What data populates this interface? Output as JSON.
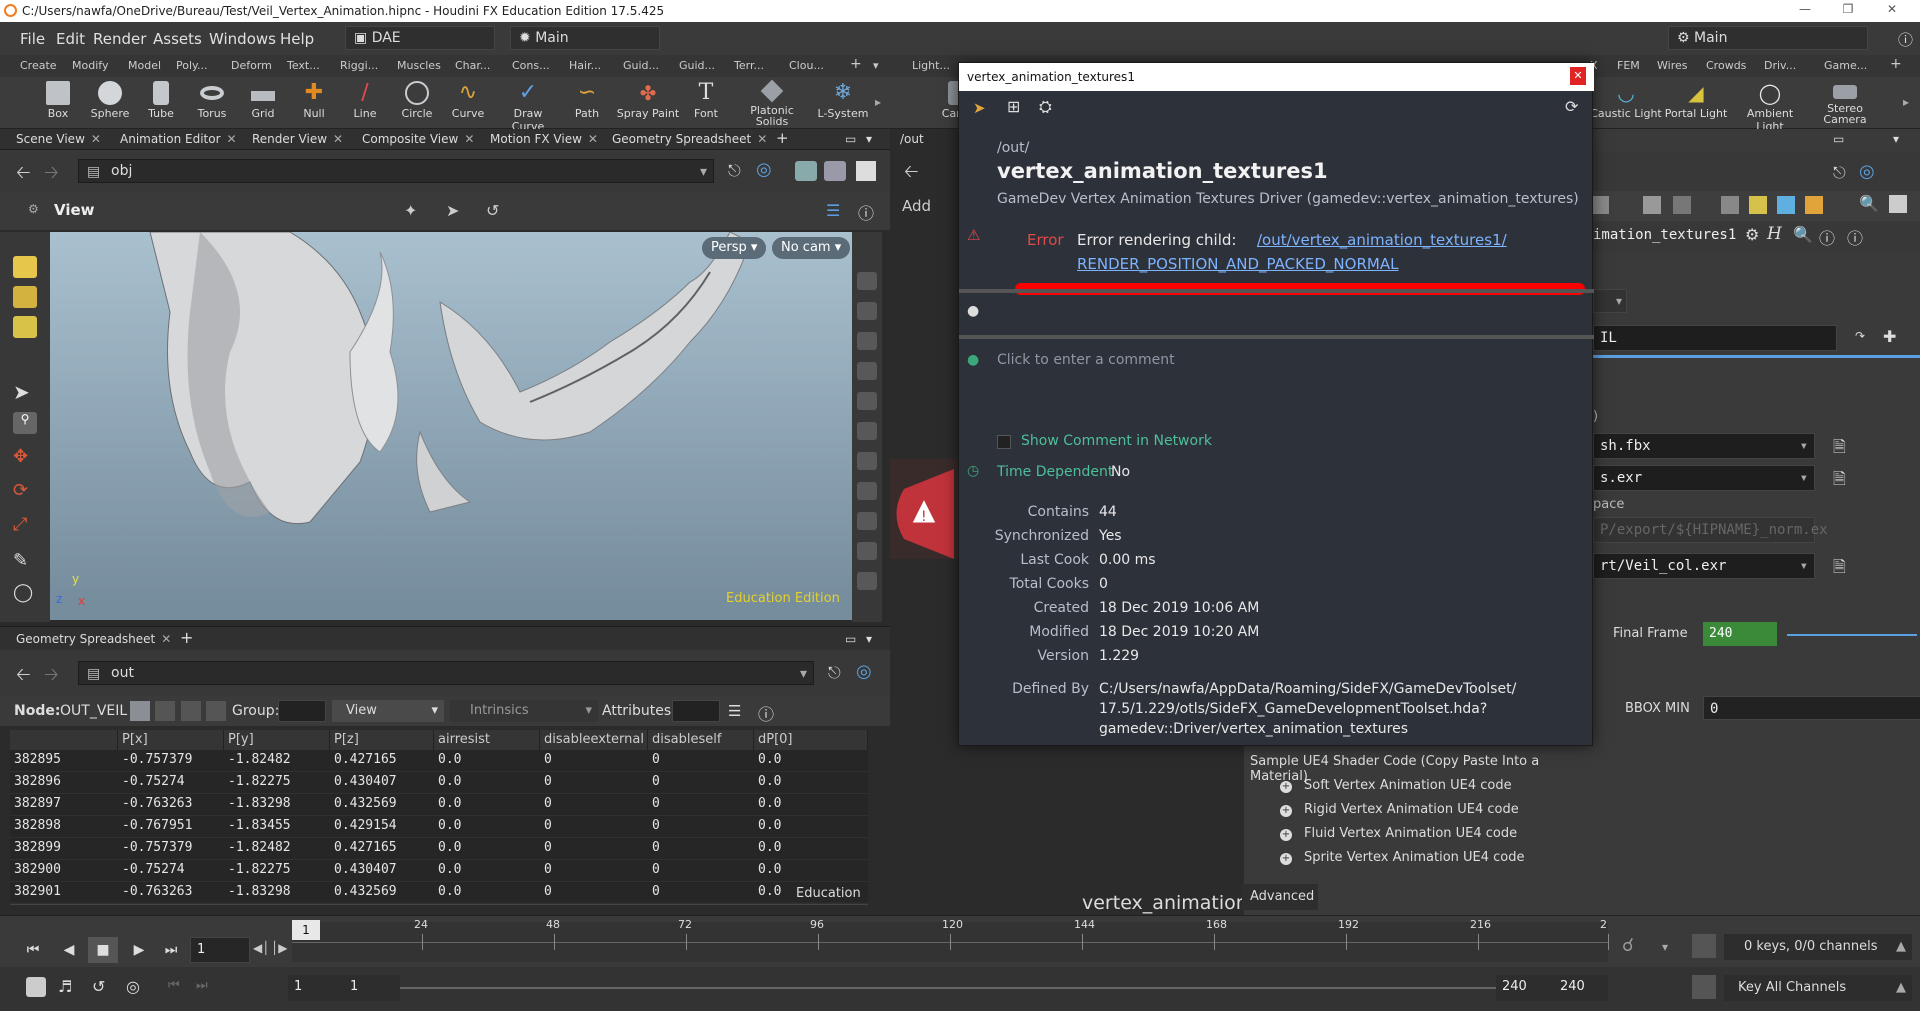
{
  "window": {
    "title": "C:/Users/nawfa/OneDrive/Bureau/Test/Veil_Vertex_Animation.hipnc - Houdini FX Education Edition 17.5.425"
  },
  "menu": [
    "File",
    "Edit",
    "Render",
    "Assets",
    "Windows",
    "Help"
  ],
  "desktop_combo": "DAE",
  "main_combo": "Main",
  "main_combo_right": "Main",
  "shelf_tabs": [
    "Create",
    "Modify",
    "Model",
    "Poly...",
    "Deform",
    "Text...",
    "Riggi...",
    "Muscles",
    "Char...",
    "Cons...",
    "Hair...",
    "Guid...",
    "Guid...",
    "Terr...",
    "Clou..."
  ],
  "shelf_tabs_right": [
    "Light...",
    "X",
    "FEM",
    "Wires",
    "Crowds",
    "Driv...",
    "Game..."
  ],
  "shelf_tools": [
    "Box",
    "Sphere",
    "Tube",
    "Torus",
    "Grid",
    "Null",
    "Line",
    "Circle",
    "Curve",
    "Draw Curve",
    "Path",
    "Spray Paint",
    "Font",
    "Platonic Solids",
    "L-System"
  ],
  "shelf_tools_right": [
    "Camer",
    "Caustic Light",
    "Portal Light",
    "Ambient Light",
    "Stereo Camera"
  ],
  "pane_tabs": [
    "Scene View",
    "Animation Editor",
    "Render View",
    "Composite View",
    "Motion FX View",
    "Geometry Spreadsheet"
  ],
  "net_tab": "/out",
  "scene_path": "obj",
  "view_label": "View",
  "persp_btn": "Persp",
  "cam_btn": "No cam",
  "edu_watermark": "Education Edition",
  "axes": {
    "y": "y",
    "z": "z",
    "x": "x"
  },
  "gs": {
    "tab": "Geometry Spreadsheet",
    "path": "out",
    "node_label": "Node:",
    "node_name": "OUT_VEIL",
    "group_label": "Group:",
    "view_label": "View",
    "intrinsics_label": "Intrinsics",
    "attributes_label": "Attributes:",
    "columns": [
      "",
      "P[x]",
      "P[y]",
      "P[z]",
      "airresist",
      "disableexternal",
      "disableself",
      "dP[0]"
    ],
    "rows": [
      [
        "382895",
        "-0.757379",
        "-1.82482",
        "0.427165",
        "0.0",
        "0",
        "0",
        "0.0"
      ],
      [
        "382896",
        "-0.75274",
        "-1.82275",
        "0.430407",
        "0.0",
        "0",
        "0",
        "0.0"
      ],
      [
        "382897",
        "-0.763263",
        "-1.83298",
        "0.432569",
        "0.0",
        "0",
        "0",
        "0.0"
      ],
      [
        "382898",
        "-0.767951",
        "-1.83455",
        "0.429154",
        "0.0",
        "0",
        "0",
        "0.0"
      ],
      [
        "382899",
        "-0.757379",
        "-1.82482",
        "0.427165",
        "0.0",
        "0",
        "0",
        "0.0"
      ],
      [
        "382900",
        "-0.75274",
        "-1.82275",
        "0.430407",
        "0.0",
        "0",
        "0",
        "0.0"
      ],
      [
        "382901",
        "-0.763263",
        "-1.83298",
        "0.432569",
        "0.0",
        "0",
        "0",
        "0.0"
      ]
    ],
    "watermark": "Education"
  },
  "net": {
    "add_label": "Add",
    "node_caption": "vertex_animation"
  },
  "popup": {
    "title": "vertex_animation_textures1",
    "path": "/out/",
    "name": "vertex_animation_textures1",
    "type": "GameDev Vertex Animation Textures Driver (gamedev::vertex_animation_textures)",
    "error_label": "Error",
    "error_text": "Error rendering child: ",
    "error_link_1": "/out/vertex_animation_textures1/",
    "error_link_2": "RENDER_POSITION_AND_PACKED_NORMAL",
    "comment_placeholder": "Click to enter a comment",
    "show_comment": "Show Comment in Network",
    "time_dep_label": "Time Dependent",
    "time_dep_value": "No",
    "info": [
      {
        "k": "Contains",
        "v": "44"
      },
      {
        "k": "Synchronized",
        "v": "Yes"
      },
      {
        "k": "Last Cook",
        "v": "0.00 ms"
      },
      {
        "k": "Total Cooks",
        "v": "0"
      },
      {
        "k": "Created",
        "v": "18 Dec 2019 10:06 AM"
      },
      {
        "k": "Modified",
        "v": "18 Dec 2019 10:20 AM"
      },
      {
        "k": "Version",
        "v": "1.229"
      }
    ],
    "defined_by_label": "Defined By",
    "defined_by_1": "C:/Users/nawfa/AppData/Roaming/SideFX/GameDevToolset/",
    "defined_by_2": "17.5/1.229/otls/SideFX_GameDevelopmentToolset.hda?",
    "defined_by_3": "gamedev::Driver/vertex_animation_textures"
  },
  "params": {
    "node_name": "imation_textures1",
    "veil": "IL",
    "paren": ")",
    "mesh": "sh.fbx",
    "exr": "s.exr",
    "space": "pace",
    "norm": "P/export/${HIPNAME}_norm.ex",
    "col": "rt/Veil_col.exr",
    "final_frame_label": "Final Frame",
    "final_frame": "240",
    "bbox_min_label": "BBOX MIN",
    "bbox_min": "0",
    "sample_title": "Sample UE4 Shader Code (Copy Paste Into a Material)",
    "ue4": [
      "Soft Vertex Animation UE4 code",
      "Rigid Vertex Animation UE4 code",
      "Fluid Vertex Animation UE4 code",
      "Sprite Vertex Animation UE4 code"
    ],
    "advanced_tab": "Advanced"
  },
  "timeline": {
    "frame": "1",
    "current_marker": "1",
    "ticks": [
      "24",
      "48",
      "72",
      "96",
      "120",
      "144",
      "168",
      "192",
      "216",
      "2"
    ],
    "start": "1",
    "start2": "1",
    "end": "240",
    "end2": "240",
    "keys": "0 keys, 0/0 channels",
    "key_all": "Key All Channels"
  }
}
